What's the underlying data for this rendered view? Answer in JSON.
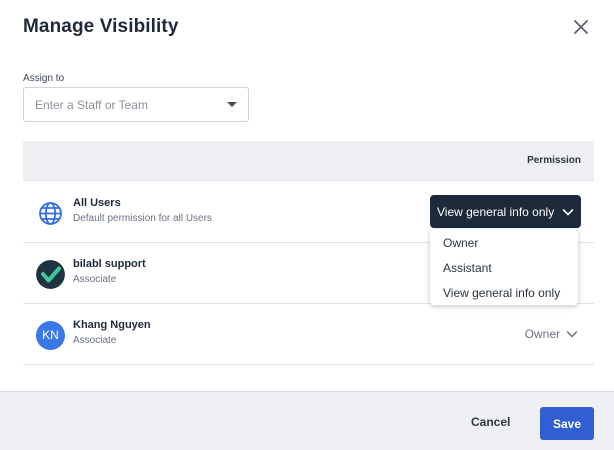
{
  "dialog": {
    "title": "Manage Visibility",
    "close_icon": "close-icon"
  },
  "assign": {
    "label": "Assign to",
    "placeholder": "Enter a Staff or Team",
    "value": ""
  },
  "table": {
    "permission_header": "Permission",
    "rows": [
      {
        "name": "All Users",
        "subtitle": "Default permission for all Users",
        "icon": "globe-icon",
        "permission": "View general info only",
        "accent": "#2f6fe0"
      },
      {
        "name": "bilabl support",
        "subtitle": "Associate",
        "icon": "bilabl-logo-icon",
        "permission": ""
      },
      {
        "name": "Khang Nguyen",
        "subtitle": "Associate",
        "initials": "KN",
        "avatar_color": "#3b78e7",
        "permission": "Owner"
      }
    ]
  },
  "permission_dropdown": {
    "options": [
      "Owner",
      "Assistant",
      "View general info only"
    ]
  },
  "footer": {
    "cancel_label": "Cancel",
    "save_label": "Save"
  },
  "colors": {
    "primary": "#2f5fd0",
    "dark_select": "#1d2a3a",
    "header_bg": "#eef0f3"
  }
}
